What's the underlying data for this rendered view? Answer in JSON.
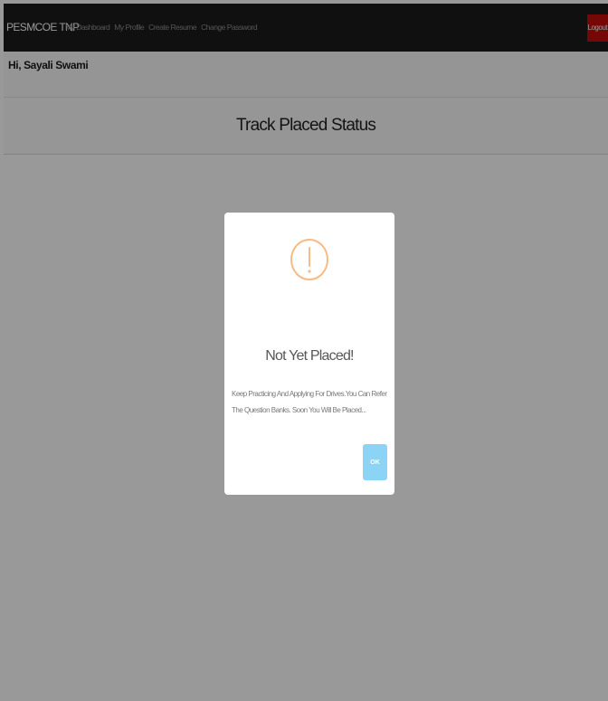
{
  "navbar": {
    "brand": "PESMCOE TNP",
    "links": [
      "My Dashboard",
      "My Profile",
      "Create Resume",
      "Change Password"
    ],
    "logout_label": "Logout"
  },
  "greeting": "Hi, Sayali Swami",
  "page": {
    "title": "Track Placed Status"
  },
  "modal": {
    "icon": "warning-exclamation-icon",
    "title": "Not Yet Placed!",
    "message": "Keep Practicing And Applying For Drives.You Can Refer The Question Banks. Soon You Will Be Placed...",
    "confirm_label": "OK"
  },
  "colors": {
    "navbar": "#1b1b1b",
    "logout": "#c60b0b",
    "warning": "#f8bb86",
    "confirm_button": "#8cd4f5"
  }
}
